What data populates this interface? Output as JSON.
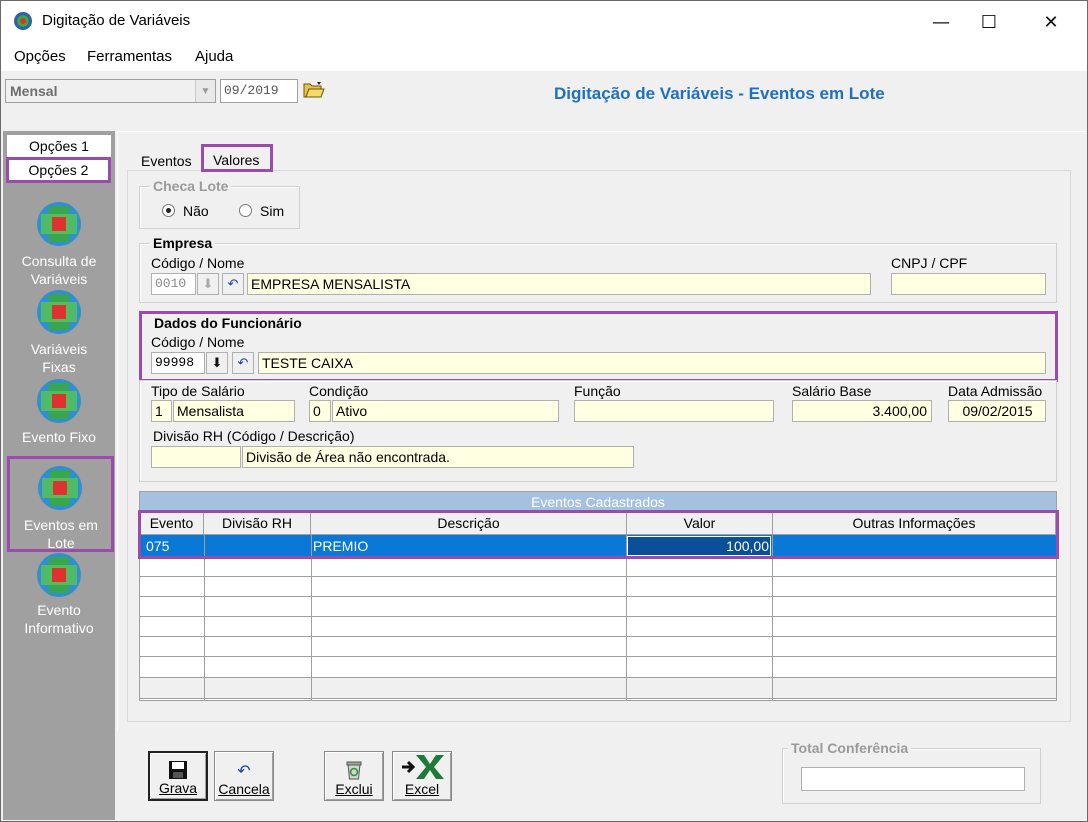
{
  "window": {
    "title": "Digitação de Variáveis",
    "controls": {
      "minimize": "—",
      "maximize": "☐",
      "close": "✕"
    }
  },
  "menu": [
    "Opções",
    "Ferramentas",
    "Ajuda"
  ],
  "toolbar": {
    "period_select": "Mensal",
    "competence": "09/2019",
    "open_icon": "folder-open-icon",
    "screen_title": "Digitação de Variáveis - Eventos em Lote"
  },
  "sidebar": {
    "tabs": [
      "Opções 1",
      "Opções 2"
    ],
    "active_tab": "Opções 2",
    "items": [
      {
        "label_line1": "Consulta de",
        "label_line2": "Variáveis",
        "icon": "variables-query-icon"
      },
      {
        "label_line1": "Variáveis",
        "label_line2": "Fixas",
        "icon": "fixed-variables-icon"
      },
      {
        "label_line1": "Evento Fixo",
        "label_line2": "",
        "icon": "fixed-event-icon"
      },
      {
        "label_line1": "Eventos em",
        "label_line2": "Lote",
        "icon": "batch-events-icon"
      },
      {
        "label_line1": "Evento",
        "label_line2": "Informativo",
        "icon": "informative-event-icon"
      }
    ],
    "active_item": "Eventos em Lote"
  },
  "tabs": [
    "Eventos",
    "Valores"
  ],
  "active_tab": "Valores",
  "checa_lote": {
    "title": "Checa Lote",
    "options": [
      "Não",
      "Sim"
    ],
    "selected": "Não"
  },
  "empresa": {
    "title": "Empresa",
    "code_label": "Código / Nome",
    "code": "0010",
    "name": "EMPRESA MENSALISTA",
    "cnpj_label": "CNPJ / CPF",
    "cnpj": ""
  },
  "funcionario": {
    "title": "Dados do Funcionário",
    "code_label": "Código / Nome",
    "code": "99998",
    "name": "TESTE CAIXA"
  },
  "details": {
    "tipo_salario_label": "Tipo de Salário",
    "tipo_salario_code": "1",
    "tipo_salario": "Mensalista",
    "condicao_label": "Condição",
    "condicao_code": "0",
    "condicao": "Ativo",
    "funcao_label": "Função",
    "funcao": "",
    "salario_label": "Salário Base",
    "salario": "3.400,00",
    "admissao_label": "Data Admissão",
    "admissao": "09/02/2015",
    "divisao_label": "Divisão RH (Código / Descrição)",
    "divisao_code": "",
    "divisao": "Divisão de Área não encontrada."
  },
  "grid": {
    "caption": "Eventos Cadastrados",
    "columns": [
      "Evento",
      "Divisão RH",
      "Descrição",
      "Valor",
      "Outras Informações"
    ],
    "rows": [
      {
        "evento": "075",
        "divisao": "",
        "descricao": "PREMIO",
        "valor": "100,00",
        "outras": ""
      }
    ]
  },
  "buttons": {
    "save": "Grava",
    "cancel": "Cancela",
    "delete": "Exclui",
    "excel": "Excel"
  },
  "total": {
    "title": "Total Conferência",
    "value": ""
  },
  "colors": {
    "accent_title": "#1f70c1",
    "highlight_border": "#9b4bad",
    "selected_row": "#0a78d7",
    "sidebar_bg": "#a0a0a0",
    "field_yellow": "#ffffe1"
  }
}
